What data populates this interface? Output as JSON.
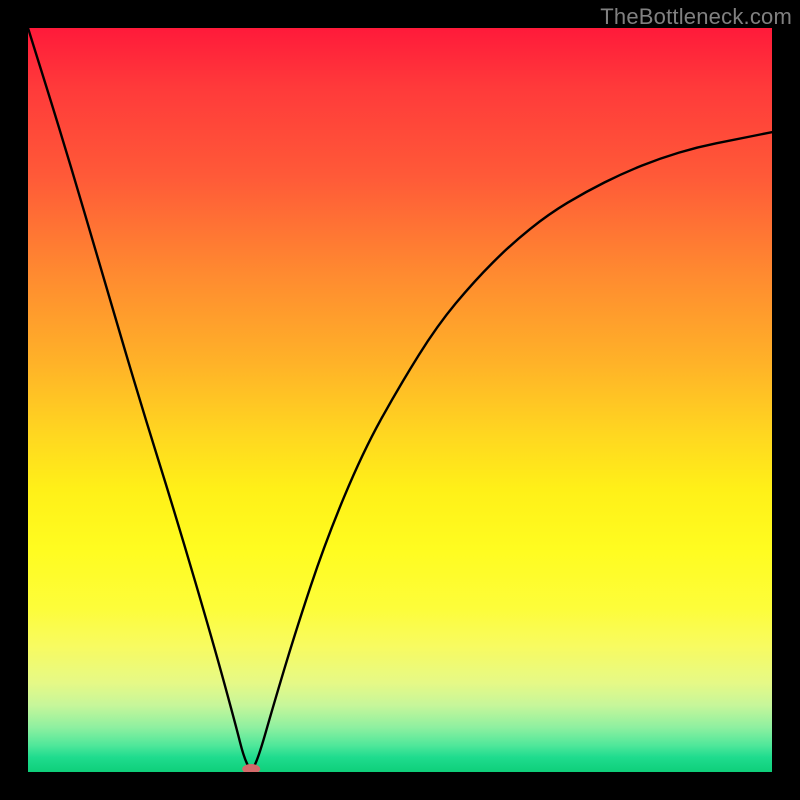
{
  "watermark": {
    "text": "TheBottleneck.com"
  },
  "chart_data": {
    "type": "line",
    "title": "",
    "xlabel": "",
    "ylabel": "",
    "xlim": [
      0,
      100
    ],
    "ylim": [
      0,
      100
    ],
    "grid": false,
    "legend": false,
    "annotations": [],
    "minimum_marker": {
      "x": 30,
      "y": 0,
      "color": "#d46a6a"
    },
    "series": [
      {
        "name": "bottleneck-curve",
        "color": "#000000",
        "x": [
          0,
          5,
          10,
          15,
          20,
          25,
          28,
          29,
          30,
          31,
          33,
          36,
          40,
          45,
          50,
          55,
          60,
          65,
          70,
          75,
          80,
          85,
          90,
          95,
          100
        ],
        "y": [
          100,
          84,
          67,
          50,
          34,
          17,
          6,
          2,
          0,
          2,
          9,
          19,
          31,
          43,
          52,
          60,
          66,
          71,
          75,
          78,
          80.5,
          82.5,
          84,
          85,
          86
        ]
      }
    ]
  }
}
